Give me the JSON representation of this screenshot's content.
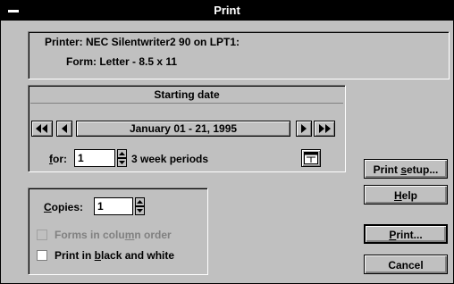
{
  "window": {
    "title": "Print"
  },
  "printer": {
    "printer_line": "Printer: NEC Silentwriter2 90 on LPT1:",
    "form_line": "Form: Letter - 8.5 x 11"
  },
  "starting_date": {
    "header": "Starting date",
    "range_text": "January 01 - 21, 1995",
    "for_label_pre": "",
    "for_label_key": "f",
    "for_label_post": "or:",
    "for_value": "1",
    "period_label": "3 week periods"
  },
  "copies": {
    "label_key": "C",
    "label_rest": "opies:",
    "value": "1",
    "forms_pre": "Forms in colu",
    "forms_key": "m",
    "forms_post": "n order",
    "bw_pre": "Print in ",
    "bw_key": "b",
    "bw_post": "lack and white"
  },
  "buttons": {
    "print_setup": {
      "pre": "Print ",
      "key": "s",
      "post": "etup..."
    },
    "help": {
      "pre": "",
      "key": "H",
      "post": "elp"
    },
    "print": {
      "pre": "",
      "key": "P",
      "post": "rint..."
    },
    "cancel": "Cancel"
  },
  "icons": {
    "first": "double-left-arrow-icon",
    "prev": "left-arrow-icon",
    "next": "right-arrow-icon",
    "last": "double-right-arrow-icon",
    "calendar": "calendar-icon"
  }
}
